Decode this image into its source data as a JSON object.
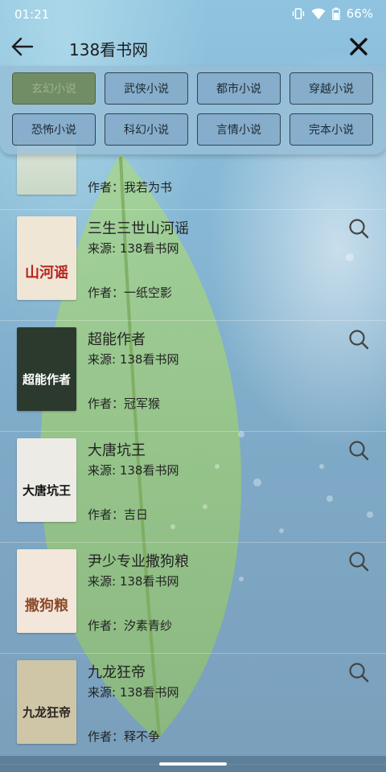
{
  "status_bar": {
    "time": "01:21",
    "battery": "66%"
  },
  "header": {
    "title": "138看书网"
  },
  "categories": [
    {
      "label": "玄幻小说",
      "active": true
    },
    {
      "label": "武侠小说"
    },
    {
      "label": "都市小说"
    },
    {
      "label": "穿越小说"
    },
    {
      "label": "恐怖小说"
    },
    {
      "label": "科幻小说"
    },
    {
      "label": "言情小说"
    },
    {
      "label": "完本小说"
    }
  ],
  "books": [
    {
      "title": "",
      "source": "",
      "author": "作者：我若为书",
      "cover_text": "",
      "partial": true
    },
    {
      "title": "三生三世山河谣",
      "source": "来源: 138看书网",
      "author": "作者：一纸空影",
      "cover_text": "山河谣",
      "cover_color": "#efe6d6",
      "cover_text_color": "#b8241e"
    },
    {
      "title": "超能作者",
      "source": "来源: 138看书网",
      "author": "作者：冠军猴",
      "cover_text": "超能作者",
      "cover_color": "#2c3a2e",
      "cover_text_color": "#ffffff"
    },
    {
      "title": "大唐坑王",
      "source": "来源: 138看书网",
      "author": "作者：吉日",
      "cover_text": "大唐坑王",
      "cover_color": "#ecebe6",
      "cover_text_color": "#111111"
    },
    {
      "title": "尹少专业撒狗粮",
      "source": "来源: 138看书网",
      "author": "作者：汐素青纱",
      "cover_text": "撒狗粮",
      "cover_color": "#f3e7dc",
      "cover_text_color": "#8c4a2a"
    },
    {
      "title": "九龙狂帝",
      "source": "来源: 138看书网",
      "author": "作者：释不争",
      "cover_text": "九龙狂帝",
      "cover_color": "#cfc6a8",
      "cover_text_color": "#2a2520"
    }
  ],
  "colors": {
    "active_category": "#718d66",
    "category_button": "#84aac9",
    "panel": "#96bed6"
  },
  "icons": {
    "back": "arrow-left-icon",
    "close": "close-icon",
    "search": "search-icon"
  }
}
